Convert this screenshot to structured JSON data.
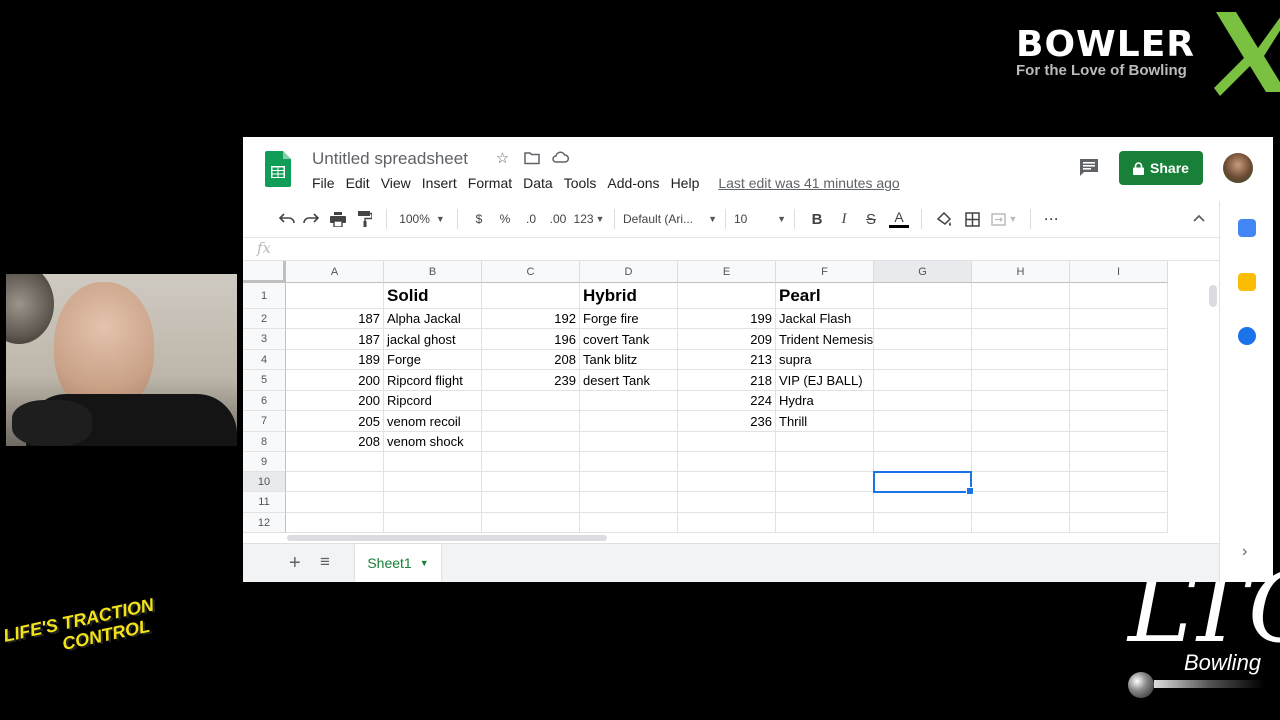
{
  "overlay": {
    "brand_title": "BOWLER",
    "brand_tagline": "For the Love of Bowling",
    "ltc_left_line1": "LIFE'S TRACTION",
    "ltc_left_line2": "CONTROL",
    "ltc_right_big": "LTC",
    "ltc_right_sub": "Bowling"
  },
  "sheets": {
    "doc_title": "Untitled spreadsheet",
    "menu": [
      "File",
      "Edit",
      "View",
      "Insert",
      "Format",
      "Data",
      "Tools",
      "Add-ons",
      "Help"
    ],
    "last_edit": "Last edit was 41 minutes ago",
    "share_label": "Share",
    "toolbar": {
      "zoom": "100%",
      "currency": "$",
      "percent": "%",
      "dec_less": ".0",
      "dec_more": ".00",
      "more_formats": "123",
      "font": "Default (Ari...",
      "font_size": "10",
      "bold": "B",
      "italic": "I",
      "strike": "S",
      "text_color": "A"
    },
    "fx_label": "fx",
    "columns": [
      "A",
      "B",
      "C",
      "D",
      "E",
      "F",
      "G",
      "H",
      "I"
    ],
    "rows": [
      "1",
      "2",
      "3",
      "4",
      "5",
      "6",
      "7",
      "8",
      "9",
      "10",
      "11",
      "12"
    ],
    "cells": {
      "B1": "Solid",
      "D1": "Hybrid",
      "F1": "Pearl",
      "A2": "187",
      "B2": "Alpha Jackal",
      "C2": "192",
      "D2": "Forge fire",
      "E2": "199",
      "F2": "Jackal Flash",
      "A3": "187",
      "B3": "jackal ghost",
      "C3": "196",
      "D3": "covert Tank",
      "E3": "209",
      "F3": "Trident Nemesis",
      "A4": "189",
      "B4": "Forge",
      "C4": "208",
      "D4": "Tank blitz",
      "E4": "213",
      "F4": "supra",
      "A5": "200",
      "B5": "Ripcord flight",
      "C5": "239",
      "D5": "desert Tank",
      "E5": "218",
      "F5": "VIP (EJ BALL)",
      "A6": "200",
      "B6": "Ripcord",
      "E6": "224",
      "F6": "Hydra",
      "A7": "205",
      "B7": "venom recoil",
      "E7": "236",
      "F7": "Thrill",
      "A8": "208",
      "B8": "venom shock"
    },
    "sheet_tab": "Sheet1",
    "colors": {
      "share_green": "#188038",
      "selection_blue": "#1a73e8",
      "brand_green": "#7ac142"
    }
  }
}
